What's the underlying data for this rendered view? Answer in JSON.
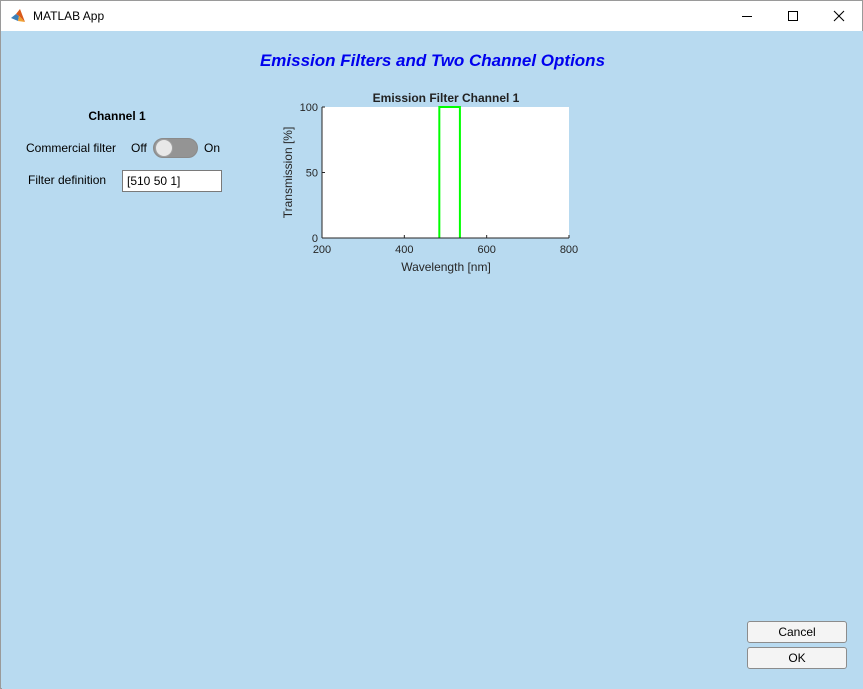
{
  "window": {
    "title": "MATLAB App",
    "icon": "matlab-icon",
    "controls": [
      "minimize-icon",
      "maximize-icon",
      "close-icon"
    ]
  },
  "page": {
    "title": "Emission Filters and Two Channel Options",
    "title_color": "#0000ee",
    "background": "#b8daf0"
  },
  "channel1": {
    "heading": "Channel 1",
    "commercial_filter_label": "Commercial filter",
    "switch_off_label": "Off",
    "switch_on_label": "On",
    "switch_state": "Off",
    "filter_definition_label": "Filter definition",
    "filter_definition_value": "[510 50 1]"
  },
  "chart_data": {
    "type": "line",
    "title": "Emission Filter Channel 1",
    "xlabel": "Wavelength [nm]",
    "ylabel": "Transmission [%]",
    "xlim": [
      200,
      800
    ],
    "ylim": [
      0,
      100
    ],
    "xticks": [
      200,
      400,
      600,
      800
    ],
    "yticks": [
      0,
      50,
      100
    ],
    "grid": false,
    "series": [
      {
        "color": "#00ff00",
        "x": [
          485,
          485,
          535,
          535
        ],
        "y": [
          0,
          100,
          100,
          0
        ]
      }
    ]
  },
  "buttons": {
    "cancel": "Cancel",
    "ok": "OK"
  }
}
